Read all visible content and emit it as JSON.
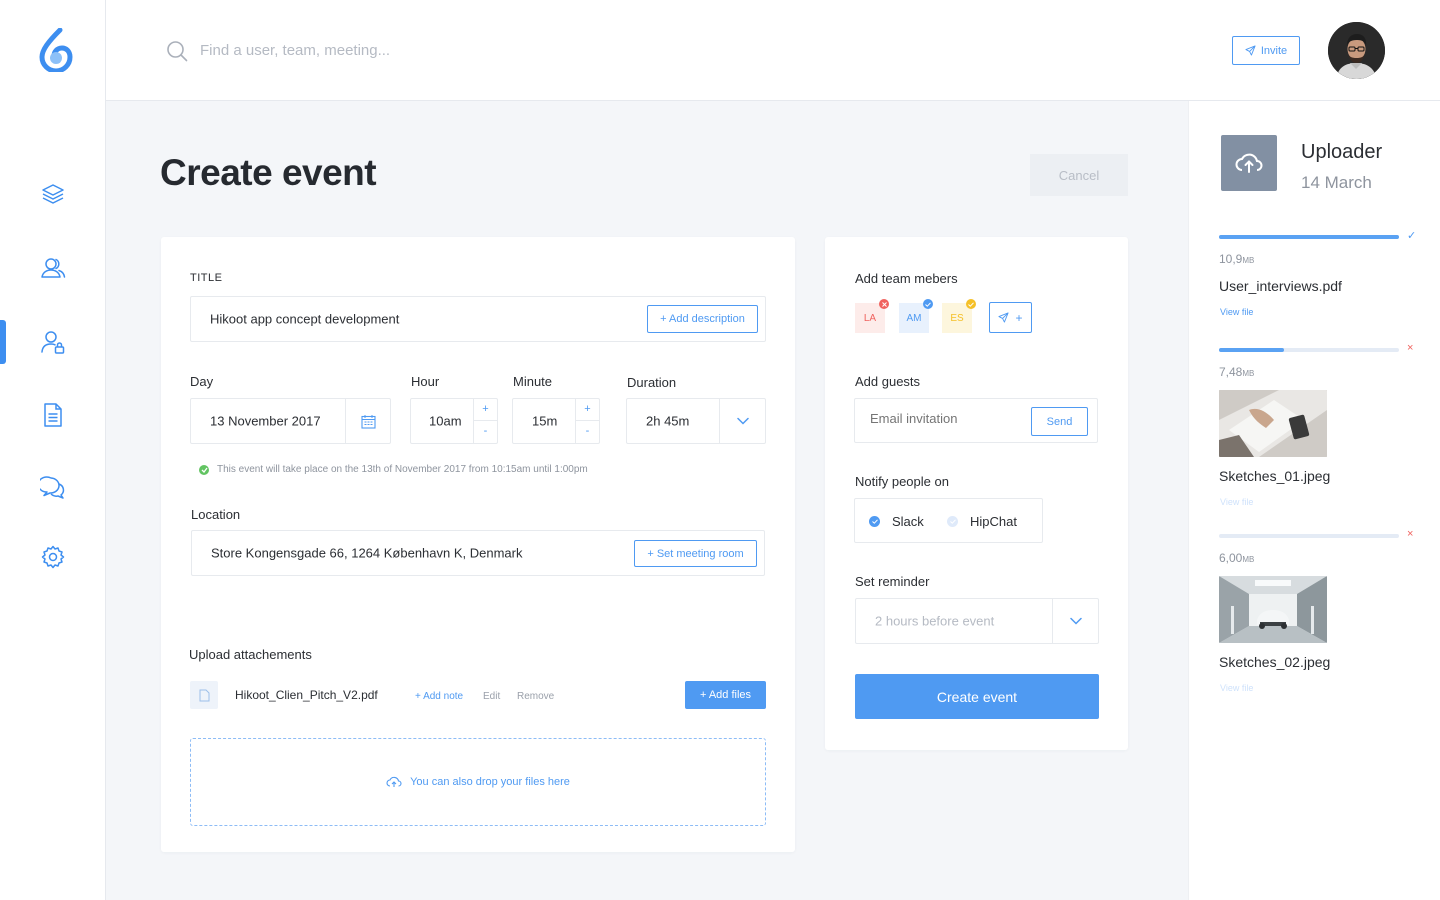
{
  "colors": {
    "accent": "#4f9af2",
    "success": "#62c462",
    "danger": "#f0625e",
    "warning": "#f5c028"
  },
  "nav": {
    "logo_icon": "drop-logo-icon",
    "items": [
      {
        "icon": "layers-icon"
      },
      {
        "icon": "users-icon"
      },
      {
        "icon": "user-lock-icon",
        "active": true
      },
      {
        "icon": "document-icon"
      },
      {
        "icon": "chat-icon"
      },
      {
        "icon": "gear-icon"
      }
    ]
  },
  "topbar": {
    "search_placeholder": "Find a user, team, meeting...",
    "invite_label": "Invite"
  },
  "page": {
    "title": "Create event",
    "cancel_label": "Cancel"
  },
  "form": {
    "title_label": "TITLE",
    "title_value": "Hikoot app concept development",
    "add_description": "+ Add description",
    "day_label": "Day",
    "day_value": "13 November 2017",
    "hour_label": "Hour",
    "hour_value": "10am",
    "minute_label": "Minute",
    "minute_value": "15m",
    "duration_label": "Duration",
    "duration_value": "2h 45m",
    "stepper_plus": "+",
    "stepper_minus": "-",
    "hint": "This event will take place on the 13th of November 2017 from 10:15am until 1:00pm",
    "location_label": "Location",
    "location_value": "Store Kongensgade 66, 1264 København K, Denmark",
    "set_room": "+ Set meeting room",
    "attachments_label": "Upload attachements",
    "attachment": {
      "name": "Hikoot_Clien_Pitch_V2.pdf",
      "add_note": "+ Add note",
      "edit": "Edit",
      "remove": "Remove"
    },
    "add_files": "+ Add files",
    "dropzone": "You can also drop your files here"
  },
  "side": {
    "team_label": "Add team mebers",
    "members": [
      {
        "initials": "LA",
        "color": "#f0625e",
        "bg": "#fdecea"
      },
      {
        "initials": "AM",
        "color": "#4f9af2",
        "bg": "#e8f1fd"
      },
      {
        "initials": "ES",
        "color": "#f5c028",
        "bg": "#fdf6dd"
      }
    ],
    "add_member": "+",
    "guests_label": "Add guests",
    "email_placeholder": "Email invitation",
    "send_label": "Send",
    "notify_label": "Notify people on",
    "notify_options": [
      {
        "label": "Slack",
        "checked": true
      },
      {
        "label": "HipChat",
        "checked": false
      }
    ],
    "reminder_label": "Set reminder",
    "reminder_value": "2 hours before event",
    "create_label": "Create event"
  },
  "uploader": {
    "title": "Uploader",
    "date": "14 March",
    "files": [
      {
        "size": "10,9",
        "unit": "MB",
        "name": "User_interviews.pdf",
        "link": "View file",
        "progress": 1.0,
        "status": "✓",
        "status_color": "#4f9af2",
        "thumb": "none",
        "link_color": "#4f9af2"
      },
      {
        "size": "7,48",
        "unit": "MB",
        "name": "Sketches_01.jpeg",
        "link": "View file",
        "progress": 0.36,
        "status": "×",
        "status_color": "#f0625e",
        "thumb": "desk",
        "link_color": "#cfe2fb"
      },
      {
        "size": "6,00",
        "unit": "MB",
        "name": "Sketches_02.jpeg",
        "link": "View file",
        "progress": 0.0,
        "status": "×",
        "status_color": "#f0625e",
        "thumb": "car",
        "link_color": "#cfe2fb"
      }
    ]
  }
}
